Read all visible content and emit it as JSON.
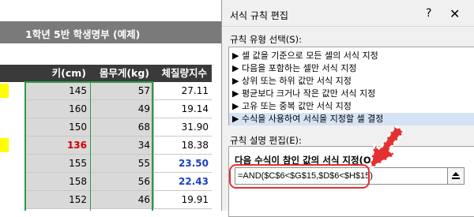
{
  "sheet": {
    "title": "1학년 5반 학생명부 (예제)",
    "headers": [
      "키(cm)",
      "몸무게(kg)",
      "체질량지수"
    ],
    "rows": [
      {
        "height": "145",
        "weight": "57",
        "bmi": "27.11",
        "height_style": "normal",
        "bmi_style": "normal",
        "highlight": true
      },
      {
        "height": "160",
        "weight": "49",
        "bmi": "19.14",
        "height_style": "normal",
        "bmi_style": "normal",
        "highlight": false
      },
      {
        "height": "150",
        "weight": "68",
        "bmi": "31.90",
        "height_style": "normal",
        "bmi_style": "normal",
        "highlight": false
      },
      {
        "height": "136",
        "weight": "34",
        "bmi": "18.38",
        "height_style": "red",
        "bmi_style": "normal",
        "highlight": true
      },
      {
        "height": "155",
        "weight": "55",
        "bmi": "23.50",
        "height_style": "normal",
        "bmi_style": "blue",
        "highlight": false
      },
      {
        "height": "158",
        "weight": "56",
        "bmi": "22.43",
        "height_style": "normal",
        "bmi_style": "blue",
        "highlight": false
      },
      {
        "height": "152",
        "weight": "46",
        "bmi": "19.91",
        "height_style": "normal",
        "bmi_style": "normal",
        "highlight": false
      }
    ]
  },
  "dialog": {
    "title": "서식 규칙 편집",
    "help": "?",
    "close": "✕",
    "rule_type_label": "규칙 유형 선택(S):",
    "rule_types": [
      "▶ 셀 값을 기준으로 모든 셀의 서식 지정",
      "▶ 다음을 포함하는 셀만 서식 지정",
      "▶ 상위 또는 하위 값만 서식 지정",
      "▶ 평균보다 크거나 작은 값만 서식 지정",
      "▶ 고유 또는 중복 값만 서식 지정",
      "▶ 수식을 사용하여 서식을 지정할 셀 결정"
    ],
    "selected_rule_index": 5,
    "desc_label": "규칙 설명 편집(E):",
    "desc_title": "다음 수식이 참인 값의 서식 지정(O):",
    "formula": "=AND($C$6<$G$15,$D$6<$H$15)"
  },
  "colors": {
    "highlight_yellow": "#ffff00",
    "selection_green": "#2e9a47",
    "annotation_red": "#e53030",
    "value_red": "#d00000",
    "value_blue": "#1a3fc8"
  }
}
